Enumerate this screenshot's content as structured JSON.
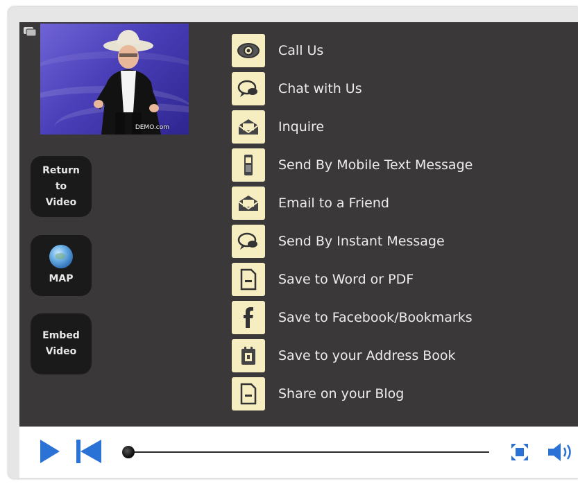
{
  "video": {
    "watermark": "DEMO.com"
  },
  "sidebar": {
    "return_label": [
      "Return",
      "to",
      "Video"
    ],
    "map_label": "MAP",
    "embed_label": [
      "Embed",
      "Video"
    ]
  },
  "menu": {
    "items": [
      {
        "label": "Call Us",
        "icon": "eye-icon"
      },
      {
        "label": "Chat with Us",
        "icon": "chat-bubble-icon"
      },
      {
        "label": "Inquire",
        "icon": "envelope-icon"
      },
      {
        "label": "Send By Mobile Text Message",
        "icon": "mobile-phone-icon"
      },
      {
        "label": "Email to a Friend",
        "icon": "envelope-icon"
      },
      {
        "label": "Send By Instant Message",
        "icon": "chat-bubble-icon"
      },
      {
        "label": "Save to Word or PDF",
        "icon": "document-icon"
      },
      {
        "label": "Save to Facebook/Bookmarks",
        "icon": "facebook-icon"
      },
      {
        "label": "Save to your Address Book",
        "icon": "address-book-icon"
      },
      {
        "label": "Share on your Blog",
        "icon": "document-icon"
      }
    ]
  },
  "player": {
    "progress": 0.0
  },
  "colors": {
    "accent": "#2b72d6",
    "panel": "#3b383a",
    "tile": "#f6edc0"
  }
}
